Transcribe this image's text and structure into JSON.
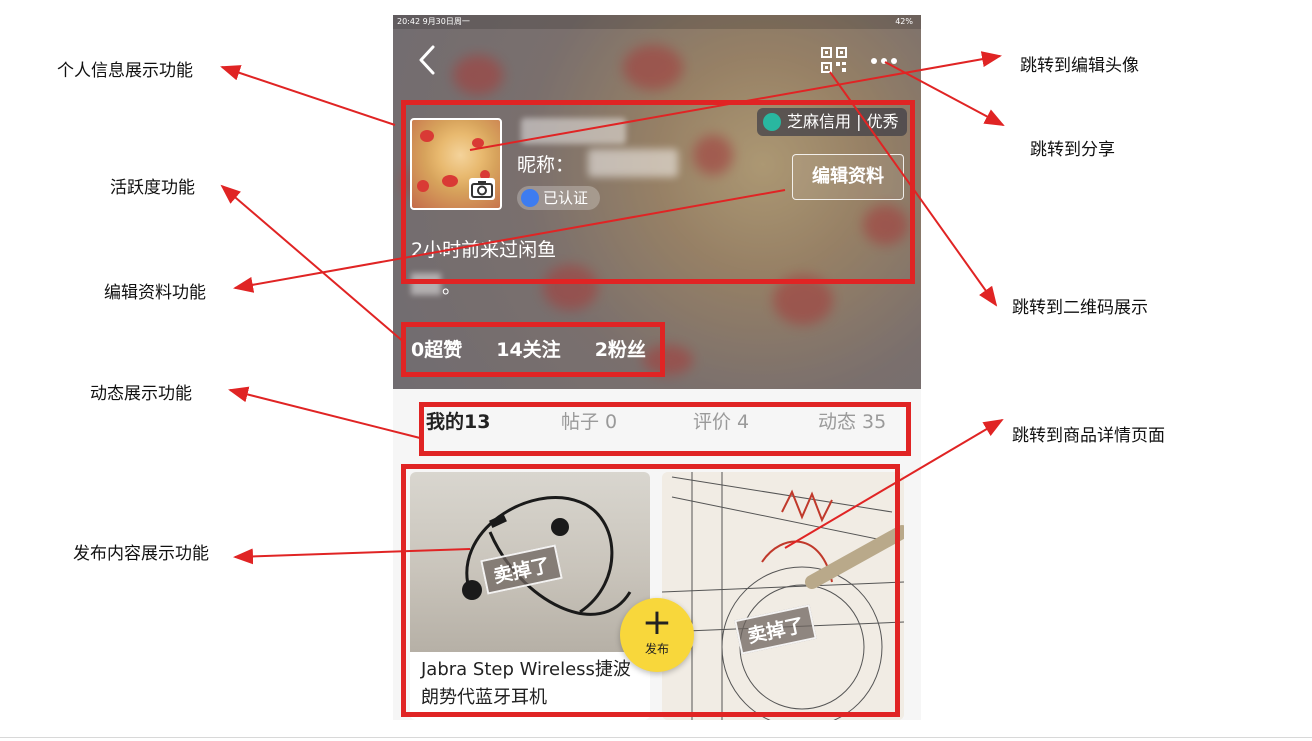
{
  "annotations": {
    "left": [
      "个人信息展示功能",
      "活跃度功能",
      "编辑资料功能",
      "动态展示功能",
      "发布内容展示功能"
    ],
    "right": [
      "跳转到编辑头像",
      "跳转到分享",
      "跳转到二维码展示",
      "跳转到商品详情页面"
    ]
  },
  "status_bar": {
    "time_date": "20:42  9月30日周一",
    "battery": "42%"
  },
  "profile": {
    "nickname_label": "昵称：",
    "verified_label": "已认证",
    "credit_label": "芝麻信用 | 优秀",
    "edit_button": "编辑资料",
    "last_visit": "2小时前来过闲鱼",
    "bio_tail": "。"
  },
  "stats": {
    "likes": "0超赞",
    "following": "14关注",
    "followers": "2粉丝"
  },
  "tabs": [
    "我的13",
    "帖子 0",
    "评价 4",
    "动态 35"
  ],
  "items": [
    {
      "title": "Jabra Step Wireless捷波朗势代蓝牙耳机",
      "badge": "卖掉了"
    },
    {
      "badge": "卖掉了"
    }
  ],
  "publish_button": {
    "icon": "+",
    "label": "发布"
  },
  "colors": {
    "highlight": "#e02424",
    "publish": "#f8d73b",
    "credit": "#29b7a0",
    "verified": "#3d7cf0"
  }
}
